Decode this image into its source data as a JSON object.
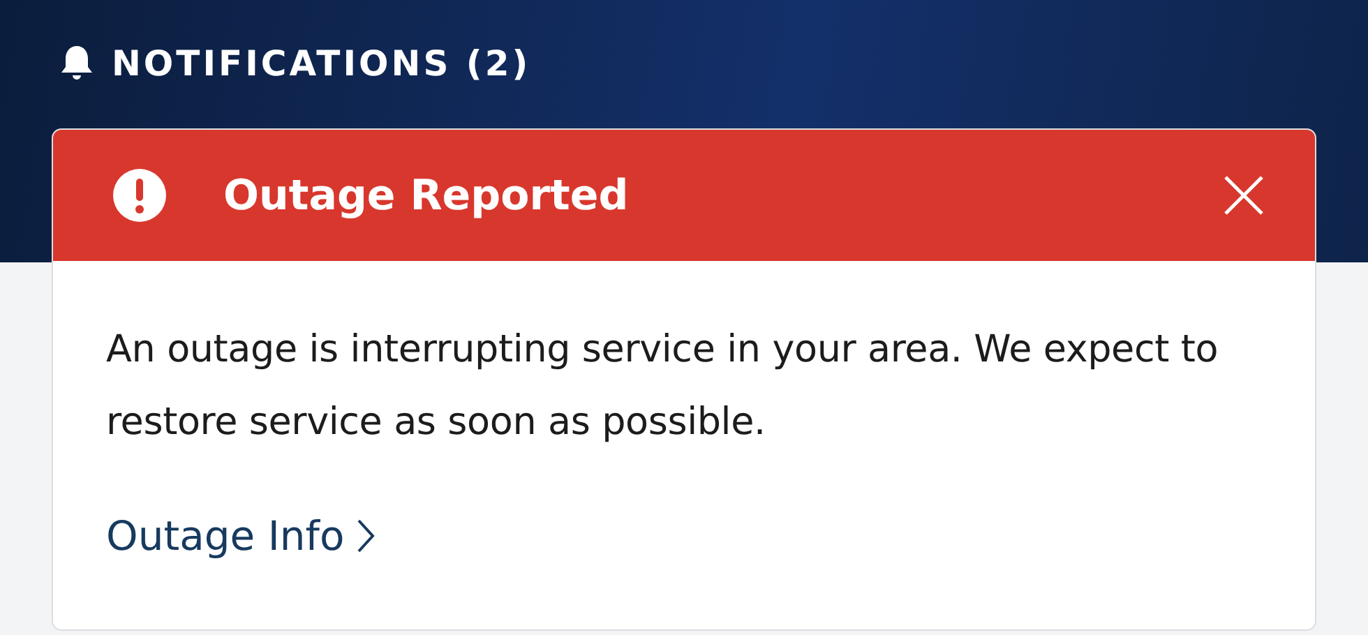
{
  "header": {
    "title": "NOTIFICATIONS (2)"
  },
  "notifications": [
    {
      "kind": "alert",
      "title": "Outage Reported",
      "message": "An outage is interrupting service in your area. We expect to restore service as soon as possible.",
      "link": "Outage Info"
    }
  ]
}
